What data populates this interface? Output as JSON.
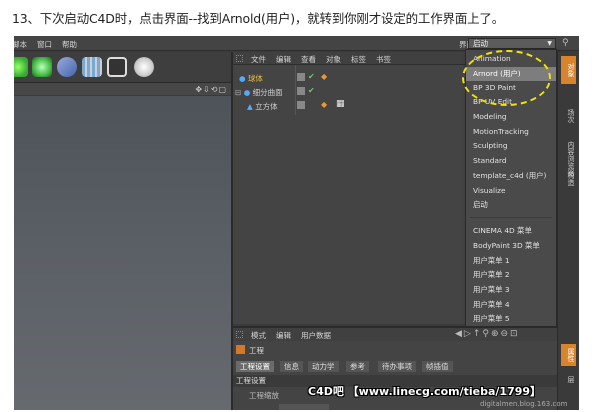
{
  "caption": "13、下次启动C4D时，点击界面--找到Arnold(用户)，就转到你刚才设定的工作界面上了。",
  "menubar": {
    "items": [
      "脚本",
      "窗口",
      "帮助"
    ],
    "layout_label": "界面:",
    "layout_value": "启动"
  },
  "toolbar_icons": [
    "sphere-tool-icon",
    "gear-tool-icon",
    "deformer-tool-icon",
    "floor-tool-icon",
    "camera-tool-icon",
    "light-tool-icon"
  ],
  "object_manager": {
    "menu": [
      "文件",
      "编辑",
      "查看",
      "对象",
      "标签",
      "书签"
    ],
    "rows": [
      {
        "name": "球体",
        "color": "#e8b84a"
      },
      {
        "name": "细分曲面",
        "color": "#cfcfcf"
      },
      {
        "name": "立方体",
        "color": "#cfcfcf"
      }
    ]
  },
  "layout_menu": {
    "group1": [
      "Animation",
      "Arnord (用户)",
      "BP 3D Paint",
      "BP UV Edit",
      "Modeling",
      "MotionTracking",
      "Sculpting",
      "Standard",
      "template_c4d (用户)",
      "Visualize",
      "启动"
    ],
    "group2": [
      "CINEMA 4D 菜单",
      "BodyPaint 3D 菜单",
      "用户菜单 1",
      "用户菜单 2",
      "用户菜单 3",
      "用户菜单 4",
      "用户菜单 5"
    ],
    "selected": "Arnord (用户)"
  },
  "side_tabs": [
    "对象",
    "场次",
    "内容浏览器",
    "构造",
    "属性",
    "层"
  ],
  "attribute_manager": {
    "menu": [
      "模式",
      "编辑",
      "用户数据"
    ],
    "title": "工程",
    "tabs": [
      "工程设置",
      "信息",
      "动力学",
      "参考",
      "待办事项",
      "帧插值"
    ],
    "section": "工程设置",
    "field_label": "工程缩放"
  },
  "watermark": "C4D吧 【www.linecg.com/tieba/1799】",
  "blog": "digitalmen.blog.163.com",
  "colors": {
    "highlight_ring": "#f1e20c",
    "accent_tab": "#d8842c"
  }
}
